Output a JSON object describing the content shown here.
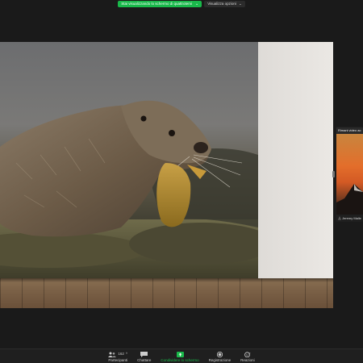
{
  "share_banner": {
    "label": "Stai visualizzando lo schermo di quattrotemi",
    "chevron": "⌄",
    "view_options": "Visualizza opzioni",
    "view_chevron": "⌄"
  },
  "side_panel": {
    "caption": "Rimani video ac",
    "participant_name": "Jeremy Malle"
  },
  "toolbar": {
    "participants": {
      "icon": "participants-icon",
      "label": "Partecipanti",
      "count": "162"
    },
    "chat": {
      "icon": "chat-icon",
      "label": "Chattare",
      "badge": ""
    },
    "share": {
      "icon": "share-screen-icon",
      "label": "Condividere lo schermo"
    },
    "record": {
      "icon": "record-icon",
      "label": "Registrazione"
    },
    "reactions": {
      "icon": "reactions-icon",
      "label": "Reazioni"
    }
  },
  "colors": {
    "accent_green": "#19b94a",
    "badge_red": "#e0312d",
    "toolbar_bg": "#1f1f1f"
  }
}
